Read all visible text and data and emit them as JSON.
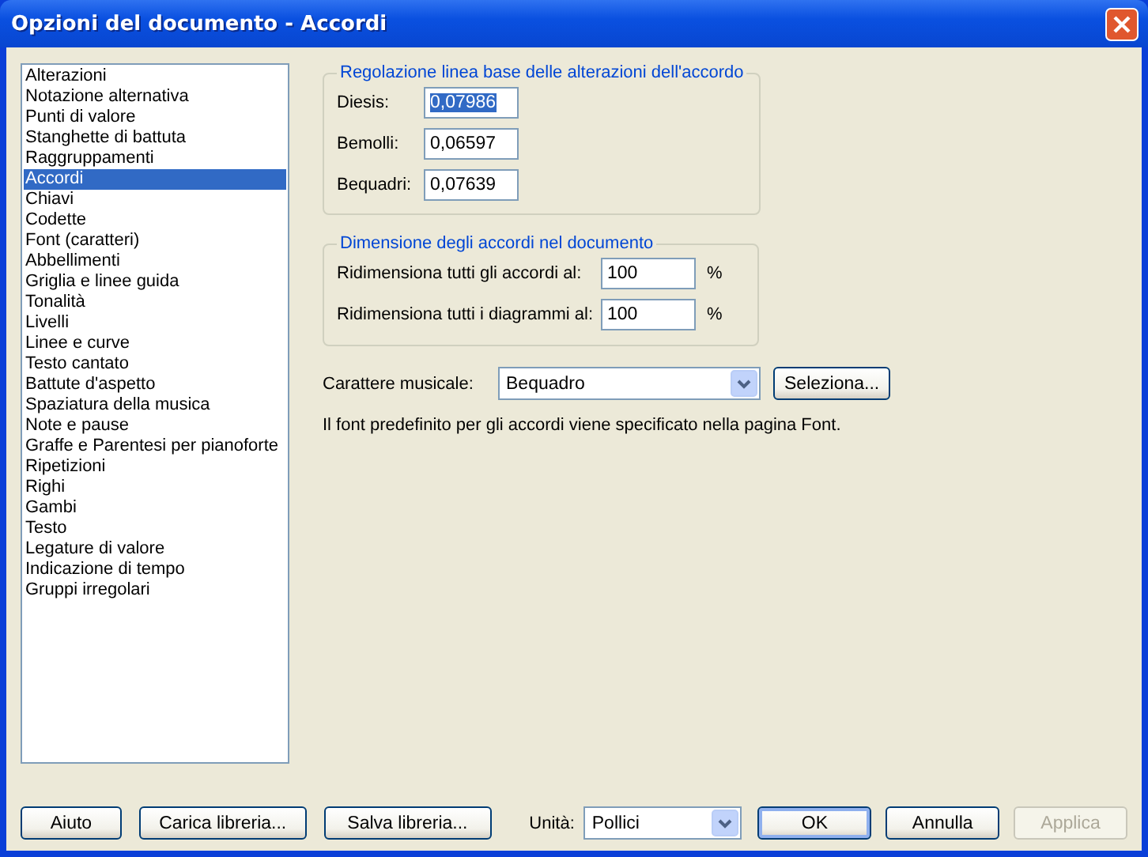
{
  "window": {
    "title": "Opzioni del documento - Accordi"
  },
  "categories": [
    {
      "label": "Alterazioni",
      "selected": false
    },
    {
      "label": "Notazione alternativa",
      "selected": false
    },
    {
      "label": "Punti di valore",
      "selected": false
    },
    {
      "label": "Stanghette di battuta",
      "selected": false
    },
    {
      "label": "Raggruppamenti",
      "selected": false
    },
    {
      "label": "Accordi",
      "selected": true
    },
    {
      "label": "Chiavi",
      "selected": false
    },
    {
      "label": "Codette",
      "selected": false
    },
    {
      "label": "Font (caratteri)",
      "selected": false
    },
    {
      "label": "Abbellimenti",
      "selected": false
    },
    {
      "label": "Griglia e linee guida",
      "selected": false
    },
    {
      "label": "Tonalità",
      "selected": false
    },
    {
      "label": "Livelli",
      "selected": false
    },
    {
      "label": "Linee e curve",
      "selected": false
    },
    {
      "label": "Testo cantato",
      "selected": false
    },
    {
      "label": "Battute d'aspetto",
      "selected": false
    },
    {
      "label": "Spaziatura della musica",
      "selected": false
    },
    {
      "label": "Note e pause",
      "selected": false
    },
    {
      "label": "Graffe e Parentesi per pianoforte",
      "selected": false
    },
    {
      "label": "Ripetizioni",
      "selected": false
    },
    {
      "label": "Righi",
      "selected": false
    },
    {
      "label": "Gambi",
      "selected": false
    },
    {
      "label": "Testo",
      "selected": false
    },
    {
      "label": "Legature di valore",
      "selected": false
    },
    {
      "label": "Indicazione di tempo",
      "selected": false
    },
    {
      "label": "Gruppi irregolari",
      "selected": false
    }
  ],
  "baseline_group": {
    "title": "Regolazione linea base delle alterazioni dell'accordo",
    "fields": [
      {
        "label": "Diesis:",
        "value": "0,07986",
        "text_selected": true
      },
      {
        "label": "Bemolli:",
        "value": "0,06597",
        "text_selected": false
      },
      {
        "label": "Bequadri:",
        "value": "0,07639",
        "text_selected": false
      }
    ]
  },
  "size_group": {
    "title": "Dimensione degli accordi nel documento",
    "fields": [
      {
        "label": "Ridimensiona tutti gli accordi al:",
        "value": "100",
        "unit": "%"
      },
      {
        "label": "Ridimensiona tutti i diagrammi al:",
        "value": "100",
        "unit": "%"
      }
    ]
  },
  "musical_character": {
    "label": "Carattere musicale:",
    "value": "Bequadro",
    "button": "Seleziona..."
  },
  "note": "Il font predefinito per gli accordi viene specificato nella pagina Font.",
  "footer": {
    "left_buttons": [
      {
        "label": "Aiuto",
        "disabled": false,
        "default": false
      },
      {
        "label": "Carica libreria...",
        "disabled": false,
        "default": false
      },
      {
        "label": "Salva libreria...",
        "disabled": false,
        "default": false
      }
    ],
    "units": {
      "label": "Unità:",
      "value": "Pollici"
    },
    "right_buttons": [
      {
        "label": "OK",
        "disabled": false,
        "default": true
      },
      {
        "label": "Annulla",
        "disabled": false,
        "default": false
      },
      {
        "label": "Applica",
        "disabled": true,
        "default": false
      }
    ]
  }
}
